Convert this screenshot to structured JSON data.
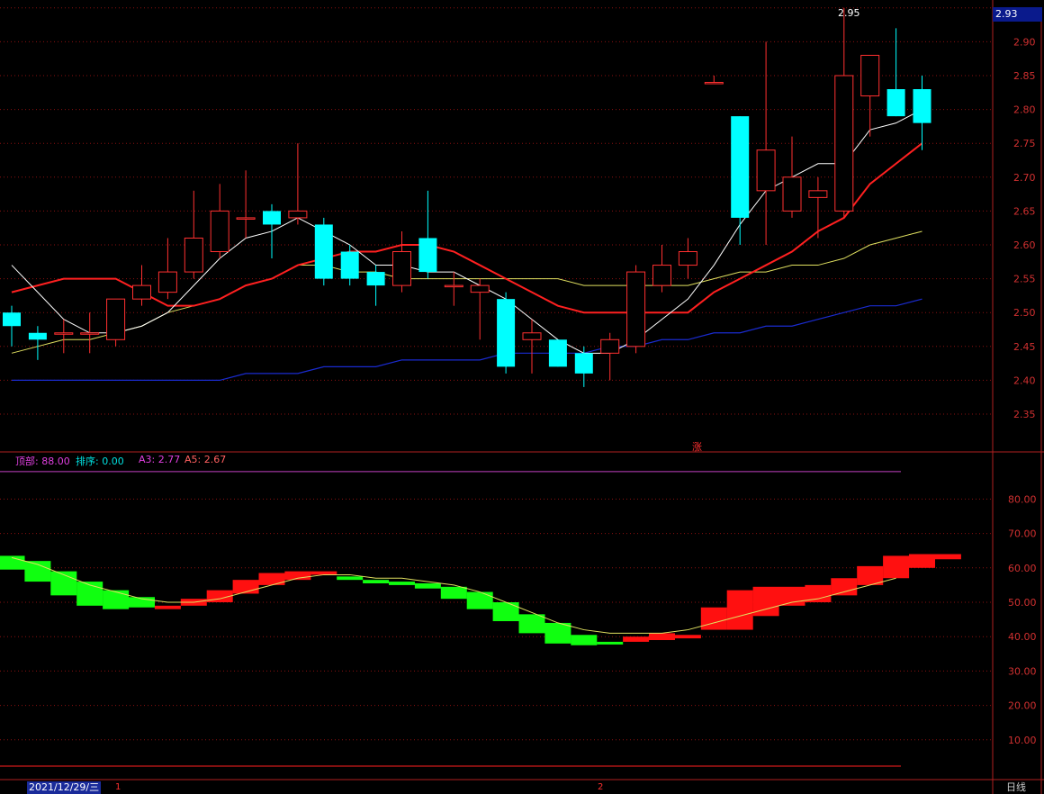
{
  "price_axis_box": "2.93",
  "peak_label": "2.95",
  "zhang_label": "涨",
  "indicator": {
    "ding_bu_label": "顶部: 88.00",
    "pai_xu_label": "排序: 0.00",
    "a3_label": "A3: 2.77",
    "a5_label": "A5: 2.67"
  },
  "footer": {
    "date": "2021/12/29/三",
    "seg1": "1",
    "seg2": "2",
    "period": "日线"
  },
  "colors": {
    "up": "#ff3030",
    "down": "#00ffff",
    "ma_fast": "#ffffff",
    "ma_red": "#ff2020",
    "ma_yellow": "#e0e060",
    "ma_blue": "#1a2bd0",
    "grid": "#8a1010",
    "ribbon_up": "#ff1010",
    "ribbon_down": "#10ff10"
  },
  "chart_data": [
    {
      "type": "candlestick",
      "ylim": [
        2.3,
        2.95
      ],
      "y_ticks": [
        "2.95",
        "2.90",
        "2.85",
        "2.80",
        "2.75",
        "2.70",
        "2.65",
        "2.60",
        "2.55",
        "2.50",
        "2.45",
        "2.40",
        "2.35"
      ],
      "candles": [
        {
          "o": 2.5,
          "h": 2.51,
          "l": 2.45,
          "c": 2.48
        },
        {
          "o": 2.47,
          "h": 2.48,
          "l": 2.43,
          "c": 2.46
        },
        {
          "o": 2.47,
          "h": 2.49,
          "l": 2.44,
          "c": 2.47
        },
        {
          "o": 2.47,
          "h": 2.5,
          "l": 2.44,
          "c": 2.47
        },
        {
          "o": 2.46,
          "h": 2.52,
          "l": 2.45,
          "c": 2.52
        },
        {
          "o": 2.52,
          "h": 2.57,
          "l": 2.51,
          "c": 2.54
        },
        {
          "o": 2.53,
          "h": 2.61,
          "l": 2.52,
          "c": 2.56
        },
        {
          "o": 2.56,
          "h": 2.68,
          "l": 2.55,
          "c": 2.61
        },
        {
          "o": 2.59,
          "h": 2.69,
          "l": 2.58,
          "c": 2.65
        },
        {
          "o": 2.64,
          "h": 2.71,
          "l": 2.61,
          "c": 2.64
        },
        {
          "o": 2.65,
          "h": 2.66,
          "l": 2.58,
          "c": 2.63
        },
        {
          "o": 2.64,
          "h": 2.75,
          "l": 2.63,
          "c": 2.65
        },
        {
          "o": 2.63,
          "h": 2.64,
          "l": 2.54,
          "c": 2.55
        },
        {
          "o": 2.59,
          "h": 2.6,
          "l": 2.54,
          "c": 2.55
        },
        {
          "o": 2.56,
          "h": 2.57,
          "l": 2.51,
          "c": 2.54
        },
        {
          "o": 2.54,
          "h": 2.62,
          "l": 2.53,
          "c": 2.59
        },
        {
          "o": 2.61,
          "h": 2.68,
          "l": 2.55,
          "c": 2.56
        },
        {
          "o": 2.54,
          "h": 2.56,
          "l": 2.51,
          "c": 2.54
        },
        {
          "o": 2.53,
          "h": 2.55,
          "l": 2.46,
          "c": 2.54
        },
        {
          "o": 2.52,
          "h": 2.53,
          "l": 2.41,
          "c": 2.42
        },
        {
          "o": 2.46,
          "h": 2.49,
          "l": 2.41,
          "c": 2.47
        },
        {
          "o": 2.46,
          "h": 2.46,
          "l": 2.42,
          "c": 2.42
        },
        {
          "o": 2.44,
          "h": 2.45,
          "l": 2.39,
          "c": 2.41
        },
        {
          "o": 2.44,
          "h": 2.47,
          "l": 2.4,
          "c": 2.46
        },
        {
          "o": 2.45,
          "h": 2.57,
          "l": 2.44,
          "c": 2.56
        },
        {
          "o": 2.54,
          "h": 2.6,
          "l": 2.53,
          "c": 2.57
        },
        {
          "o": 2.57,
          "h": 2.61,
          "l": 2.55,
          "c": 2.59
        },
        {
          "o": 2.84,
          "h": 2.85,
          "l": 2.84,
          "c": 2.84
        },
        {
          "o": 2.79,
          "h": 2.79,
          "l": 2.6,
          "c": 2.64
        },
        {
          "o": 2.68,
          "h": 2.9,
          "l": 2.6,
          "c": 2.74
        },
        {
          "o": 2.65,
          "h": 2.76,
          "l": 2.64,
          "c": 2.7
        },
        {
          "o": 2.67,
          "h": 2.7,
          "l": 2.61,
          "c": 2.68
        },
        {
          "o": 2.65,
          "h": 2.95,
          "l": 2.64,
          "c": 2.85
        },
        {
          "o": 2.82,
          "h": 2.88,
          "l": 2.76,
          "c": 2.88
        },
        {
          "o": 2.83,
          "h": 2.92,
          "l": 2.79,
          "c": 2.79
        },
        {
          "o": 2.83,
          "h": 2.85,
          "l": 2.74,
          "c": 2.78
        }
      ],
      "ma_fast": [
        2.57,
        2.53,
        2.49,
        2.47,
        2.47,
        2.48,
        2.5,
        2.54,
        2.58,
        2.61,
        2.62,
        2.64,
        2.62,
        2.6,
        2.57,
        2.57,
        2.56,
        2.56,
        2.54,
        2.52,
        2.49,
        2.46,
        2.44,
        2.44,
        2.46,
        2.49,
        2.52,
        2.57,
        2.63,
        2.68,
        2.7,
        2.72,
        2.72,
        2.77,
        2.78,
        2.8
      ],
      "ma_red": [
        2.53,
        2.54,
        2.55,
        2.55,
        2.55,
        2.53,
        2.51,
        2.51,
        2.52,
        2.54,
        2.55,
        2.57,
        2.58,
        2.59,
        2.59,
        2.6,
        2.6,
        2.59,
        2.57,
        2.55,
        2.53,
        2.51,
        2.5,
        2.5,
        2.5,
        2.5,
        2.5,
        2.53,
        2.55,
        2.57,
        2.59,
        2.62,
        2.64,
        2.69,
        2.72,
        2.75
      ],
      "ma_yellow": [
        2.44,
        2.45,
        2.46,
        2.46,
        2.47,
        2.48,
        2.5,
        2.51,
        2.52,
        2.54,
        2.55,
        2.57,
        2.57,
        2.56,
        2.56,
        2.55,
        2.55,
        2.55,
        2.55,
        2.55,
        2.55,
        2.55,
        2.54,
        2.54,
        2.54,
        2.54,
        2.54,
        2.55,
        2.56,
        2.56,
        2.57,
        2.57,
        2.58,
        2.6,
        2.61,
        2.62
      ],
      "ma_blue": [
        2.4,
        2.4,
        2.4,
        2.4,
        2.4,
        2.4,
        2.4,
        2.4,
        2.4,
        2.41,
        2.41,
        2.41,
        2.42,
        2.42,
        2.42,
        2.43,
        2.43,
        2.43,
        2.43,
        2.44,
        2.44,
        2.44,
        2.44,
        2.45,
        2.45,
        2.46,
        2.46,
        2.47,
        2.47,
        2.48,
        2.48,
        2.49,
        2.5,
        2.51,
        2.51,
        2.52
      ]
    },
    {
      "type": "ribbon",
      "ylim": [
        0,
        90
      ],
      "y_ticks": [
        "80.00",
        "70.00",
        "60.00",
        "50.00",
        "40.00",
        "30.00",
        "20.00",
        "10.00"
      ],
      "top_line": 88,
      "bottom_line": 0,
      "ribbons": [
        {
          "a": 63.5,
          "b": 59.5
        },
        {
          "a": 62.0,
          "b": 56.0
        },
        {
          "a": 59.0,
          "b": 52.0
        },
        {
          "a": 56.0,
          "b": 49.0
        },
        {
          "a": 53.5,
          "b": 48.0
        },
        {
          "a": 51.5,
          "b": 48.5
        },
        {
          "a": 48.0,
          "b": 49.0
        },
        {
          "a": 49.0,
          "b": 51.0
        },
        {
          "a": 50.0,
          "b": 53.5
        },
        {
          "a": 52.5,
          "b": 56.5
        },
        {
          "a": 55.0,
          "b": 58.5
        },
        {
          "a": 56.5,
          "b": 59.0
        },
        {
          "a": 58.0,
          "b": 59.0
        },
        {
          "a": 57.5,
          "b": 56.5
        },
        {
          "a": 56.5,
          "b": 55.5
        },
        {
          "a": 56.0,
          "b": 55.0
        },
        {
          "a": 55.5,
          "b": 54.0
        },
        {
          "a": 54.5,
          "b": 51.0
        },
        {
          "a": 53.0,
          "b": 48.0
        },
        {
          "a": 50.0,
          "b": 44.5
        },
        {
          "a": 46.5,
          "b": 41.0
        },
        {
          "a": 44.0,
          "b": 38.0
        },
        {
          "a": 40.5,
          "b": 37.5
        },
        {
          "a": 38.5,
          "b": 38.0
        },
        {
          "a": 38.5,
          "b": 40.0
        },
        {
          "a": 39.0,
          "b": 41.0
        },
        {
          "a": 39.5,
          "b": 40.5
        },
        {
          "a": 42.0,
          "b": 48.5
        },
        {
          "a": 42.0,
          "b": 53.5
        },
        {
          "a": 46.0,
          "b": 54.5
        },
        {
          "a": 49.0,
          "b": 54.5
        },
        {
          "a": 50.0,
          "b": 55.0
        },
        {
          "a": 52.0,
          "b": 57.0
        },
        {
          "a": 55.0,
          "b": 60.5
        },
        {
          "a": 57.0,
          "b": 63.5
        },
        {
          "a": 60.0,
          "b": 64.0
        },
        {
          "a": 62.5,
          "b": 64.0
        }
      ],
      "line": [
        63,
        61,
        58,
        55,
        53,
        51,
        50,
        50,
        51,
        53,
        55,
        57,
        58,
        58,
        57,
        57,
        56,
        55,
        53,
        50,
        47,
        44,
        42,
        41,
        41,
        41,
        42,
        44,
        46,
        48,
        50,
        51,
        53,
        55,
        57
      ]
    }
  ]
}
